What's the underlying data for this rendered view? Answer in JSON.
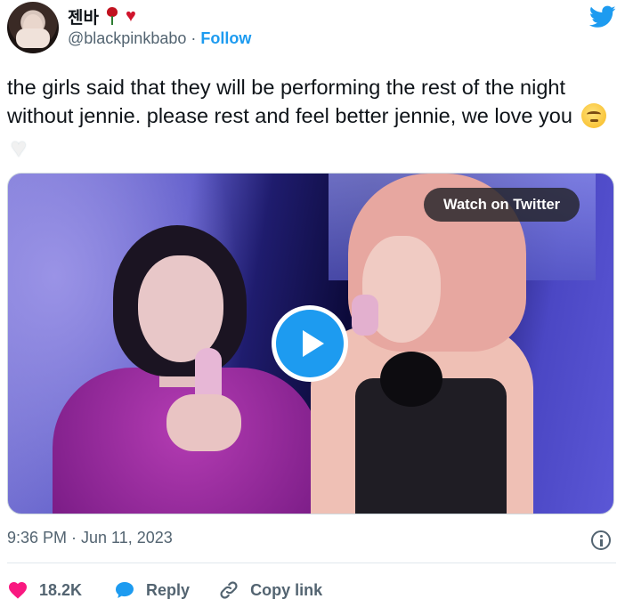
{
  "author": {
    "display_name": "젠바",
    "handle": "@blackpinkbabo",
    "separator": "·",
    "follow_label": "Follow"
  },
  "icons": {
    "brand": "twitter-bird-icon",
    "like": "heart-icon",
    "reply": "speech-bubble-icon",
    "copy": "link-icon",
    "info": "info-icon"
  },
  "tweet": {
    "text": "the girls said that they will be performing the rest of the night without jennie. please rest and feel better jennie, we love you"
  },
  "media": {
    "watch_label": "Watch on Twitter"
  },
  "meta": {
    "timestamp": "9:36 PM · Jun 11, 2023"
  },
  "actions": {
    "like_count": "18.2K",
    "reply_label": "Reply",
    "copy_label": "Copy link"
  },
  "colors": {
    "accent": "#1d9bf0",
    "like": "#f91880",
    "muted": "#536471"
  }
}
